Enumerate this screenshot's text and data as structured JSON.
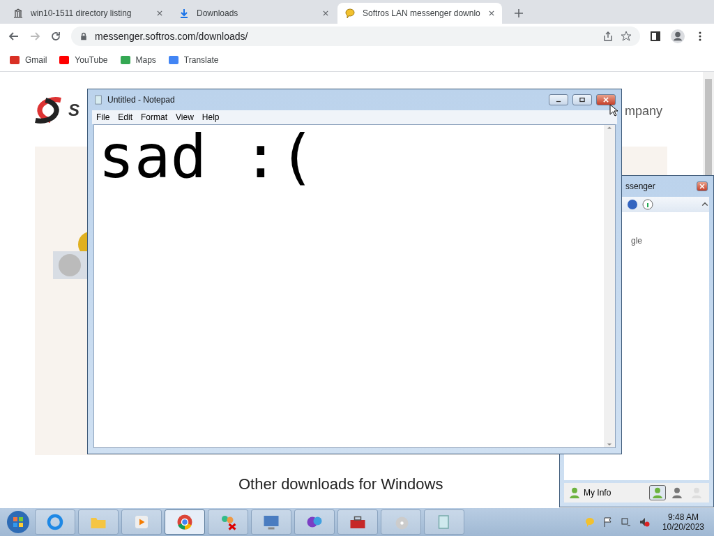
{
  "browser": {
    "tabs": [
      {
        "title": "win10-1511 directory listing",
        "kind": "archive",
        "selected": false
      },
      {
        "title": "Downloads",
        "kind": "download",
        "selected": false
      },
      {
        "title": "Softros LAN messenger downlo",
        "kind": "chat",
        "selected": true
      }
    ],
    "address": "messenger.softros.com/downloads/",
    "bookmarks": [
      {
        "label": "Gmail",
        "color": "#d93025"
      },
      {
        "label": "YouTube",
        "color": "#ff0000"
      },
      {
        "label": "Maps",
        "color": "#34a853"
      },
      {
        "label": "Translate",
        "color": "#4285f4"
      }
    ]
  },
  "page": {
    "logo_letter": "S",
    "tagline_fragment": "mpany",
    "heading": "Other downloads for Windows"
  },
  "notepad": {
    "title": "Untitled - Notepad",
    "menu": [
      "File",
      "Edit",
      "Format",
      "View",
      "Help"
    ],
    "text": "sad :("
  },
  "messenger": {
    "title_fragment": "ssenger",
    "text_fragment": "gle",
    "footer_label": "My Info",
    "statuses": [
      {
        "kind": "online",
        "selected": true
      },
      {
        "kind": "busy",
        "selected": false
      },
      {
        "kind": "offline",
        "selected": false
      }
    ]
  },
  "taskbar": {
    "apps": [
      {
        "kind": "ie",
        "active": false
      },
      {
        "kind": "folder",
        "active": false
      },
      {
        "kind": "media",
        "active": false
      },
      {
        "kind": "chrome",
        "active": true
      },
      {
        "kind": "people",
        "active": false
      },
      {
        "kind": "panel",
        "active": false
      },
      {
        "kind": "discs",
        "active": false
      },
      {
        "kind": "toolbox",
        "active": false
      },
      {
        "kind": "cd",
        "active": false
      },
      {
        "kind": "notepad",
        "active": false
      }
    ],
    "time": "9:48 AM",
    "date": "10/20/2023"
  }
}
